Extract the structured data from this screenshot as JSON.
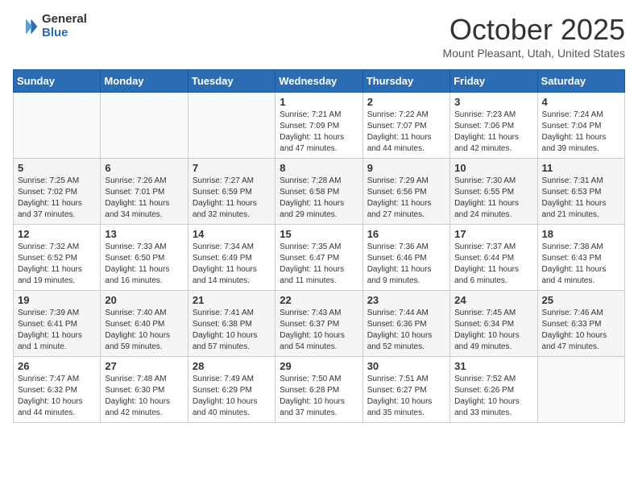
{
  "header": {
    "logo_general": "General",
    "logo_blue": "Blue",
    "month": "October 2025",
    "location": "Mount Pleasant, Utah, United States"
  },
  "weekdays": [
    "Sunday",
    "Monday",
    "Tuesday",
    "Wednesday",
    "Thursday",
    "Friday",
    "Saturday"
  ],
  "weeks": [
    [
      {
        "day": "",
        "info": ""
      },
      {
        "day": "",
        "info": ""
      },
      {
        "day": "",
        "info": ""
      },
      {
        "day": "1",
        "info": "Sunrise: 7:21 AM\nSunset: 7:09 PM\nDaylight: 11 hours and 47 minutes."
      },
      {
        "day": "2",
        "info": "Sunrise: 7:22 AM\nSunset: 7:07 PM\nDaylight: 11 hours and 44 minutes."
      },
      {
        "day": "3",
        "info": "Sunrise: 7:23 AM\nSunset: 7:06 PM\nDaylight: 11 hours and 42 minutes."
      },
      {
        "day": "4",
        "info": "Sunrise: 7:24 AM\nSunset: 7:04 PM\nDaylight: 11 hours and 39 minutes."
      }
    ],
    [
      {
        "day": "5",
        "info": "Sunrise: 7:25 AM\nSunset: 7:02 PM\nDaylight: 11 hours and 37 minutes."
      },
      {
        "day": "6",
        "info": "Sunrise: 7:26 AM\nSunset: 7:01 PM\nDaylight: 11 hours and 34 minutes."
      },
      {
        "day": "7",
        "info": "Sunrise: 7:27 AM\nSunset: 6:59 PM\nDaylight: 11 hours and 32 minutes."
      },
      {
        "day": "8",
        "info": "Sunrise: 7:28 AM\nSunset: 6:58 PM\nDaylight: 11 hours and 29 minutes."
      },
      {
        "day": "9",
        "info": "Sunrise: 7:29 AM\nSunset: 6:56 PM\nDaylight: 11 hours and 27 minutes."
      },
      {
        "day": "10",
        "info": "Sunrise: 7:30 AM\nSunset: 6:55 PM\nDaylight: 11 hours and 24 minutes."
      },
      {
        "day": "11",
        "info": "Sunrise: 7:31 AM\nSunset: 6:53 PM\nDaylight: 11 hours and 21 minutes."
      }
    ],
    [
      {
        "day": "12",
        "info": "Sunrise: 7:32 AM\nSunset: 6:52 PM\nDaylight: 11 hours and 19 minutes."
      },
      {
        "day": "13",
        "info": "Sunrise: 7:33 AM\nSunset: 6:50 PM\nDaylight: 11 hours and 16 minutes."
      },
      {
        "day": "14",
        "info": "Sunrise: 7:34 AM\nSunset: 6:49 PM\nDaylight: 11 hours and 14 minutes."
      },
      {
        "day": "15",
        "info": "Sunrise: 7:35 AM\nSunset: 6:47 PM\nDaylight: 11 hours and 11 minutes."
      },
      {
        "day": "16",
        "info": "Sunrise: 7:36 AM\nSunset: 6:46 PM\nDaylight: 11 hours and 9 minutes."
      },
      {
        "day": "17",
        "info": "Sunrise: 7:37 AM\nSunset: 6:44 PM\nDaylight: 11 hours and 6 minutes."
      },
      {
        "day": "18",
        "info": "Sunrise: 7:38 AM\nSunset: 6:43 PM\nDaylight: 11 hours and 4 minutes."
      }
    ],
    [
      {
        "day": "19",
        "info": "Sunrise: 7:39 AM\nSunset: 6:41 PM\nDaylight: 11 hours and 1 minute."
      },
      {
        "day": "20",
        "info": "Sunrise: 7:40 AM\nSunset: 6:40 PM\nDaylight: 10 hours and 59 minutes."
      },
      {
        "day": "21",
        "info": "Sunrise: 7:41 AM\nSunset: 6:38 PM\nDaylight: 10 hours and 57 minutes."
      },
      {
        "day": "22",
        "info": "Sunrise: 7:43 AM\nSunset: 6:37 PM\nDaylight: 10 hours and 54 minutes."
      },
      {
        "day": "23",
        "info": "Sunrise: 7:44 AM\nSunset: 6:36 PM\nDaylight: 10 hours and 52 minutes."
      },
      {
        "day": "24",
        "info": "Sunrise: 7:45 AM\nSunset: 6:34 PM\nDaylight: 10 hours and 49 minutes."
      },
      {
        "day": "25",
        "info": "Sunrise: 7:46 AM\nSunset: 6:33 PM\nDaylight: 10 hours and 47 minutes."
      }
    ],
    [
      {
        "day": "26",
        "info": "Sunrise: 7:47 AM\nSunset: 6:32 PM\nDaylight: 10 hours and 44 minutes."
      },
      {
        "day": "27",
        "info": "Sunrise: 7:48 AM\nSunset: 6:30 PM\nDaylight: 10 hours and 42 minutes."
      },
      {
        "day": "28",
        "info": "Sunrise: 7:49 AM\nSunset: 6:29 PM\nDaylight: 10 hours and 40 minutes."
      },
      {
        "day": "29",
        "info": "Sunrise: 7:50 AM\nSunset: 6:28 PM\nDaylight: 10 hours and 37 minutes."
      },
      {
        "day": "30",
        "info": "Sunrise: 7:51 AM\nSunset: 6:27 PM\nDaylight: 10 hours and 35 minutes."
      },
      {
        "day": "31",
        "info": "Sunrise: 7:52 AM\nSunset: 6:26 PM\nDaylight: 10 hours and 33 minutes."
      },
      {
        "day": "",
        "info": ""
      }
    ]
  ]
}
